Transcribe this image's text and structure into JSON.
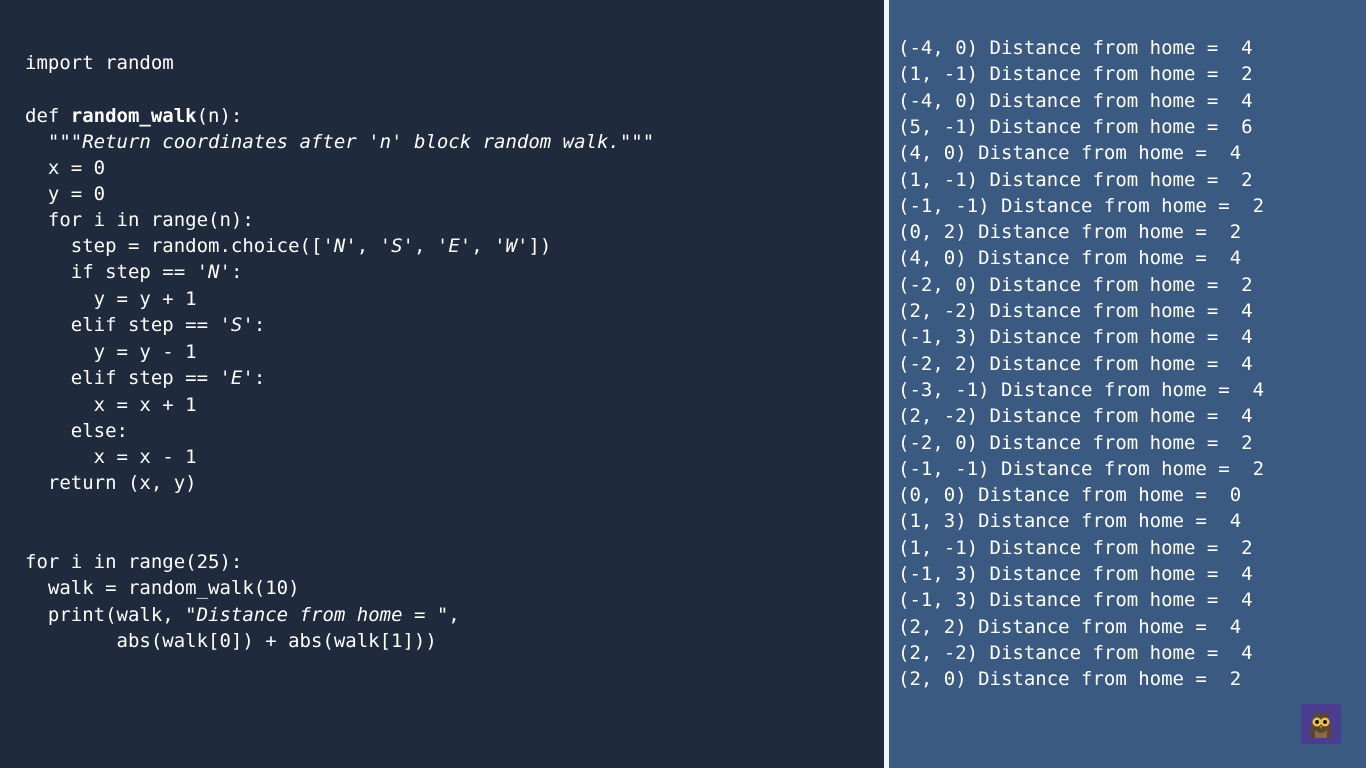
{
  "editor": {
    "lines": [
      {
        "indent": "",
        "segments": [
          {
            "t": "import random",
            "s": "plain"
          }
        ]
      },
      {
        "indent": "",
        "segments": [
          {
            "t": "def ",
            "s": "plain"
          },
          {
            "t": "random_walk",
            "s": "bold"
          },
          {
            "t": "(n):",
            "s": "plain"
          }
        ]
      },
      {
        "indent": "  ",
        "segments": [
          {
            "t": "\"\"\"Return coordinates after 'n' block random walk.\"\"\"",
            "s": "italic"
          }
        ]
      },
      {
        "indent": "  ",
        "segments": [
          {
            "t": "x = 0",
            "s": "plain"
          }
        ]
      },
      {
        "indent": "  ",
        "segments": [
          {
            "t": "y = 0",
            "s": "plain"
          }
        ]
      },
      {
        "indent": "  ",
        "segments": [
          {
            "t": "for i in range(n):",
            "s": "plain"
          }
        ]
      },
      {
        "indent": "    ",
        "segments": [
          {
            "t": "step = random.choice([",
            "s": "plain"
          },
          {
            "t": "'N'",
            "s": "italic"
          },
          {
            "t": ", ",
            "s": "plain"
          },
          {
            "t": "'S'",
            "s": "italic"
          },
          {
            "t": ", ",
            "s": "plain"
          },
          {
            "t": "'E'",
            "s": "italic"
          },
          {
            "t": ", ",
            "s": "plain"
          },
          {
            "t": "'W'",
            "s": "italic"
          },
          {
            "t": "])",
            "s": "plain"
          }
        ]
      },
      {
        "indent": "    ",
        "segments": [
          {
            "t": "if step == ",
            "s": "plain"
          },
          {
            "t": "'N'",
            "s": "italic"
          },
          {
            "t": ":",
            "s": "plain"
          }
        ]
      },
      {
        "indent": "      ",
        "segments": [
          {
            "t": "y = y + 1",
            "s": "plain"
          }
        ]
      },
      {
        "indent": "    ",
        "segments": [
          {
            "t": "elif step == ",
            "s": "plain"
          },
          {
            "t": "'S'",
            "s": "italic"
          },
          {
            "t": ":",
            "s": "plain"
          }
        ]
      },
      {
        "indent": "      ",
        "segments": [
          {
            "t": "y = y - 1",
            "s": "plain"
          }
        ]
      },
      {
        "indent": "    ",
        "segments": [
          {
            "t": "elif step == ",
            "s": "plain"
          },
          {
            "t": "'E'",
            "s": "italic"
          },
          {
            "t": ":",
            "s": "plain"
          }
        ]
      },
      {
        "indent": "      ",
        "segments": [
          {
            "t": "x = x + 1",
            "s": "plain"
          }
        ]
      },
      {
        "indent": "    ",
        "segments": [
          {
            "t": "else:",
            "s": "plain"
          }
        ]
      },
      {
        "indent": "      ",
        "segments": [
          {
            "t": "x = x - 1",
            "s": "plain"
          }
        ]
      },
      {
        "indent": "  ",
        "segments": [
          {
            "t": "return (x, y)",
            "s": "plain"
          }
        ]
      },
      {
        "indent": "",
        "segments": [
          {
            "t": "for i in range(25):",
            "s": "plain"
          }
        ]
      },
      {
        "indent": "  ",
        "segments": [
          {
            "t": "walk = random_walk(10)",
            "s": "plain"
          }
        ]
      },
      {
        "indent": "  ",
        "segments": [
          {
            "t": "print(walk, ",
            "s": "plain"
          },
          {
            "t": "\"Distance from home = \"",
            "s": "italic"
          },
          {
            "t": ",",
            "s": "plain"
          }
        ]
      },
      {
        "indent": "        ",
        "segments": [
          {
            "t": "abs(walk[0]) + abs(walk[1]))",
            "s": "plain"
          }
        ]
      }
    ]
  },
  "output": {
    "lines": [
      "(-4, 0) Distance from home =  4",
      "(1, -1) Distance from home =  2",
      "(-4, 0) Distance from home =  4",
      "(5, -1) Distance from home =  6",
      "(4, 0) Distance from home =  4",
      "(1, -1) Distance from home =  2",
      "(-1, -1) Distance from home =  2",
      "(0, 2) Distance from home =  2",
      "(4, 0) Distance from home =  4",
      "(-2, 0) Distance from home =  2",
      "(2, -2) Distance from home =  4",
      "(-1, 3) Distance from home =  4",
      "(-2, 2) Distance from home =  4",
      "(-3, -1) Distance from home =  4",
      "(2, -2) Distance from home =  4",
      "(-2, 0) Distance from home =  2",
      "(-1, -1) Distance from home =  2",
      "(0, 0) Distance from home =  0",
      "(1, 3) Distance from home =  4",
      "(1, -1) Distance from home =  2",
      "(-1, 3) Distance from home =  4",
      "(-1, 3) Distance from home =  4",
      "(2, 2) Distance from home =  4",
      "(2, -2) Distance from home =  4",
      "(2, 0) Distance from home =  2"
    ]
  },
  "logo": {
    "icon": "owl-icon"
  },
  "colors": {
    "code_bg": "#1f2a3c",
    "output_bg": "#3a5a82",
    "divider": "#f3f5f8",
    "text": "#ffffff"
  }
}
